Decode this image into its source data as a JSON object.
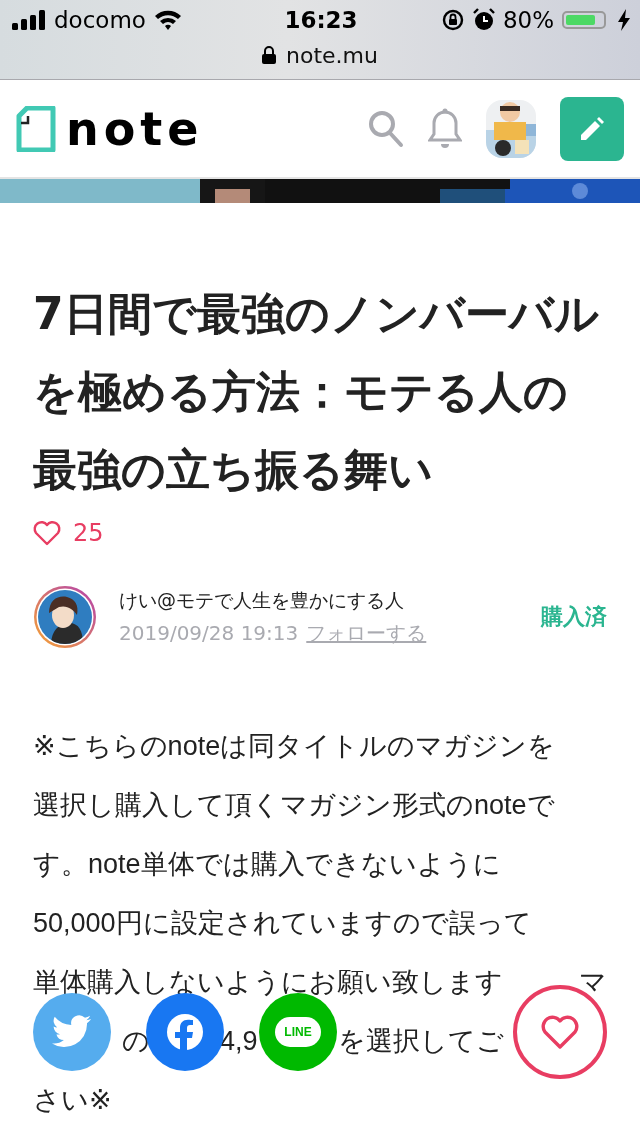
{
  "status_bar": {
    "carrier": "docomo",
    "time": "16:23",
    "battery": "80%",
    "url": "note.mu"
  },
  "header": {
    "logo": "note"
  },
  "article": {
    "title": "7日間で最強のノンバーバルを極める方法：モテる人の最強の立ち振る舞い",
    "likes": "25",
    "author": {
      "name": "けい@モテで人生を豊かにする人",
      "date": "2019/09/28 19:13",
      "follow": "フォローする"
    },
    "purchase_status": "購入済",
    "body_lines": [
      [
        "※こちらのnoteは同タイトルのマガジンを"
      ],
      [
        "選択し購入して頂くマガジン形式のnoteで"
      ],
      [
        "す。note単体では購入できないように"
      ],
      [
        "50,000円に設定されていますので誤って"
      ],
      [
        "単体購入しないようにお願い致します",
        "マ"
      ],
      [
        "の",
        "4,9",
        "を選択してご"
      ],
      [
        "さい※"
      ]
    ]
  },
  "share_buttons": [
    {
      "kind": "twitter"
    },
    {
      "kind": "facebook"
    },
    {
      "kind": "line",
      "label": "LINE"
    }
  ]
}
